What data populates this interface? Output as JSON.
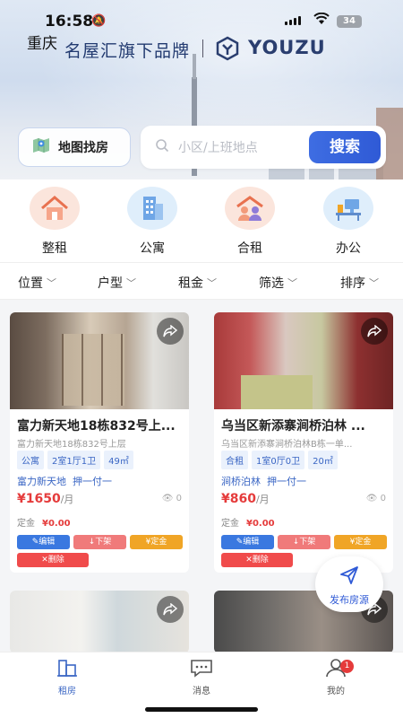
{
  "status_bar": {
    "time": "16:58",
    "battery": "34"
  },
  "header": {
    "city": "重庆",
    "brand_cn": "名屋汇旗下品牌",
    "brand_en": "YOUZU"
  },
  "search": {
    "map_button_label": "地图找房",
    "placeholder": "小区/上班地点",
    "button_label": "搜索"
  },
  "categories": [
    {
      "label": "整租",
      "icon": "house-icon"
    },
    {
      "label": "公寓",
      "icon": "apartment-building-icon"
    },
    {
      "label": "合租",
      "icon": "shared-house-icon"
    },
    {
      "label": "办公",
      "icon": "office-desk-icon"
    }
  ],
  "filters": [
    "位置",
    "户型",
    "租金",
    "筛选",
    "排序"
  ],
  "listings": [
    {
      "title": "富力新天地18栋832号上...",
      "address": "富力新天地18栋832号上层",
      "tags": [
        "公寓",
        "2室1厅1卫",
        "49㎡"
      ],
      "community": "富力新天地",
      "payment": "押一付一",
      "price": "¥1650",
      "price_unit": "/月",
      "views": "0",
      "deposit_label": "定金",
      "deposit_value": "¥0.00"
    },
    {
      "title": "乌当区新添寨涧桥泊林 ...",
      "address": "乌当区新添寨涧桥泊林B栋一单...",
      "tags": [
        "合租",
        "1室0厅0卫",
        "20㎡"
      ],
      "community": "涧桥泊林",
      "payment": "押一付一",
      "price": "¥860",
      "price_unit": "/月",
      "views": "0",
      "deposit_label": "定金",
      "deposit_value": "¥0.00"
    }
  ],
  "card_actions": {
    "edit": "✎编辑",
    "down": "↓下架",
    "deposit": "¥定金",
    "delete": "✕删除"
  },
  "fab": {
    "label": "发布房源"
  },
  "tabbar": [
    {
      "label": "租房",
      "active": true
    },
    {
      "label": "消息",
      "active": false
    },
    {
      "label": "我的",
      "active": false,
      "badge": "1"
    }
  ]
}
